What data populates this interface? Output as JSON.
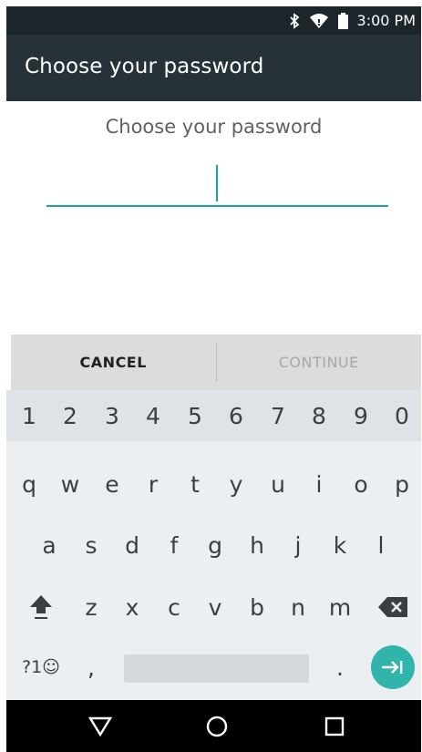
{
  "status_bar": {
    "time": "3:00 PM",
    "icons": [
      "bluetooth-icon",
      "wifi-icon",
      "battery-icon"
    ]
  },
  "app_bar": {
    "title": "Choose your password"
  },
  "content": {
    "prompt": "Choose your password",
    "password_value": ""
  },
  "buttons": {
    "cancel": "CANCEL",
    "continue": "CONTINUE"
  },
  "keyboard": {
    "numbers": [
      "1",
      "2",
      "3",
      "4",
      "5",
      "6",
      "7",
      "8",
      "9",
      "0"
    ],
    "row1": [
      "q",
      "w",
      "e",
      "r",
      "t",
      "y",
      "u",
      "i",
      "o",
      "p"
    ],
    "row2": [
      "a",
      "s",
      "d",
      "f",
      "g",
      "h",
      "j",
      "k",
      "l"
    ],
    "row3": [
      "z",
      "x",
      "c",
      "v",
      "b",
      "n",
      "m"
    ],
    "symbols_label": "?1☺",
    "comma": ",",
    "period": "."
  },
  "colors": {
    "accent": "#1ca59b",
    "appbar": "#263238",
    "statusbar": "#1c2529"
  }
}
